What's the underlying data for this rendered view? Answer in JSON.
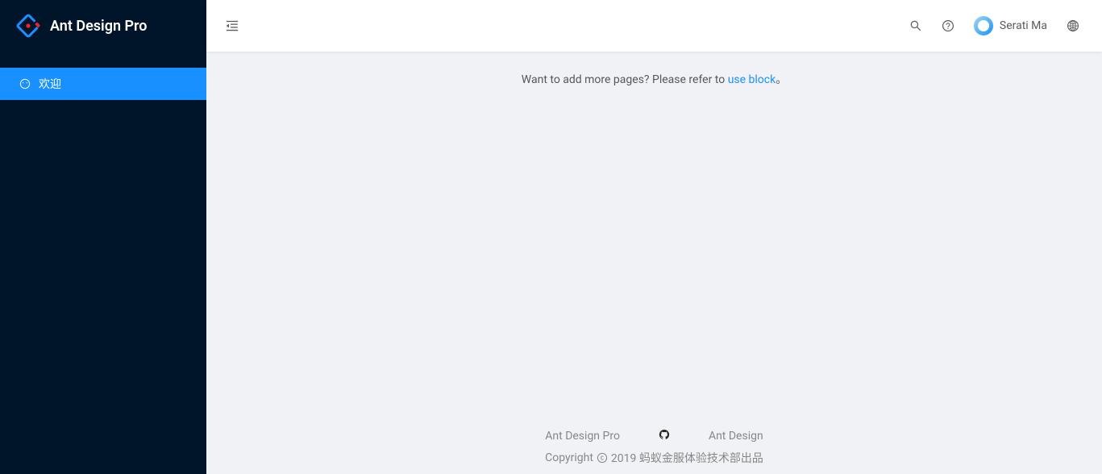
{
  "sidebar": {
    "title": "Ant Design Pro",
    "items": [
      {
        "label": "欢迎",
        "selected": true
      }
    ]
  },
  "header": {
    "username": "Serati Ma"
  },
  "content": {
    "text_before": "Want to add more pages? Please refer to ",
    "link_text": "use block",
    "text_after": "。"
  },
  "footer": {
    "links": [
      {
        "label": "Ant Design Pro"
      },
      {
        "label": "Ant Design"
      }
    ],
    "copyright_before": "Copyright",
    "copyright_after": "2019 蚂蚁金服体验技术部出品"
  }
}
